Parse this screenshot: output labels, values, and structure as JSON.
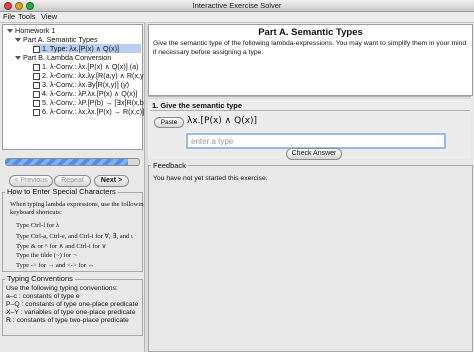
{
  "window": {
    "title": "Interactive Exercise Solver"
  },
  "menu": {
    "file": "File",
    "tools": "Tools",
    "view": "View"
  },
  "tree": {
    "root": "Homework 1",
    "partA": "Part A. Semantic Types",
    "partA_items": [
      "1. Type: λx.[P(x) ∧ Q(x)]"
    ],
    "partB": "Part B. Lambda Conversion",
    "partB_items": [
      "1. λ-Conv.: λx.[P(x) ∧ Q(x)] (a)",
      "2. λ-Conv.: λx.λy.[R(a,y) ∧ R(x,y)]",
      "3. λ-Conv.: λx.∃y[R(x,y)] (y)",
      "4. λ-Conv.: λP.λx.[P(x) ∧ Q(x)]",
      "5. λ-Conv.: λP.[P(b) → [∃x[R(x,b)]",
      "6. λ-Conv.: λx.λx.[P(x) → R(x,c)]"
    ]
  },
  "progress": {
    "fraction": 0.92
  },
  "nav": {
    "previous": "< Previous",
    "repeat": "Repeat",
    "next": "Next >"
  },
  "help": {
    "title": "How to Enter Special Characters",
    "intro1": "When typing lambda expressions, use the following",
    "intro2": "keyboard shortcuts:",
    "lines": [
      "Type Ctrl-l for λ",
      "Type Ctrl-a, Ctrl-e, and Ctrl-i for ∀, ∃, and ι",
      "Type & or ^ for ∧ and Ctrl-i for ∨",
      "Type the tilde (~) for ¬",
      "Type -> for → and <-> for ↔"
    ]
  },
  "conventions": {
    "title": "Typing Conventions",
    "lines": [
      "Use the following typing conventions:",
      "a–c : constants of type e",
      "P–Q : constants of type one-place predicate",
      "X–Y : variables of type one-place predicate",
      "R : constants of type two-place predicate"
    ]
  },
  "part": {
    "heading": "Part A. Semantic Types",
    "description": "Give the semantic type of the following lambda-expressions. You may want to simplify them in your mind if necessary before assigning a type."
  },
  "question": {
    "title": "1. Give the semantic type",
    "paste": "Paste",
    "expression": "λx.[P(x) ∧ Q(x)]",
    "input_placeholder": "enter a type",
    "input_value": "",
    "check": "Check Answer"
  },
  "feedback": {
    "title": "Feedback",
    "text": "You have not yet started this exercise."
  },
  "colors": {
    "selection": "#b8cff2",
    "focus_ring": "#9ab9ea",
    "progress": "#4f8fe6"
  }
}
